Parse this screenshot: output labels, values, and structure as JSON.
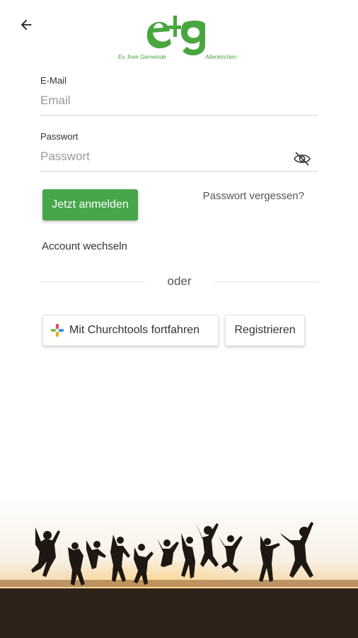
{
  "header": {
    "back_icon": "arrow-left-icon",
    "logo": {
      "mark": "eg",
      "subtitle_left": "Ev. freie Gemeinde",
      "subtitle_right": "Altenkirchen",
      "color": "#4aa63f"
    }
  },
  "form": {
    "email": {
      "label": "E-Mail",
      "placeholder": "Email",
      "value": ""
    },
    "password": {
      "label": "Passwort",
      "placeholder": "Passwort",
      "value": "",
      "toggle_icon": "eye-off-icon"
    },
    "login_button": "Jetzt anmelden",
    "forgot_password": "Passwort vergessen?",
    "switch_account": "Account wechseln"
  },
  "divider": {
    "label": "oder"
  },
  "alt_actions": {
    "churchtools_button": "Mit Churchtools fortfahren",
    "churchtools_icon": "churchtools-icon",
    "register_button": "Registrieren"
  },
  "colors": {
    "accent": "#47a64a",
    "text": "#333333",
    "placeholder": "#9a9a9a"
  },
  "footer": {
    "image": "jumping-people-sunset-silhouette"
  }
}
